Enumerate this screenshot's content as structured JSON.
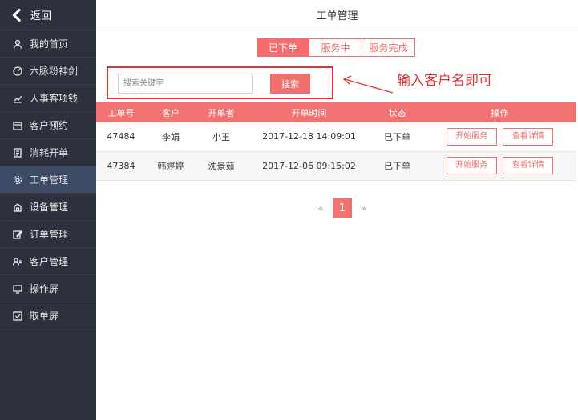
{
  "sidebar": {
    "back_label": "返回",
    "items": [
      {
        "label": "我的首页",
        "icon": "user-icon"
      },
      {
        "label": "六脉粉神剑",
        "icon": "dashboard-icon"
      },
      {
        "label": "人事客项钱",
        "icon": "chart-icon"
      },
      {
        "label": "客户预约",
        "icon": "calendar-icon"
      },
      {
        "label": "消耗开单",
        "icon": "document-icon"
      },
      {
        "label": "工单管理",
        "icon": "gear-icon",
        "active": true
      },
      {
        "label": "设备管理",
        "icon": "building-icon"
      },
      {
        "label": "订单管理",
        "icon": "edit-icon"
      },
      {
        "label": "客户管理",
        "icon": "users-icon"
      },
      {
        "label": "操作屏",
        "icon": "monitor-icon"
      },
      {
        "label": "取单屏",
        "icon": "checkbox-icon"
      }
    ]
  },
  "header": {
    "title": "工单管理"
  },
  "tabs": [
    {
      "label": "已下单",
      "active": true
    },
    {
      "label": "服务中",
      "active": false
    },
    {
      "label": "服务完成",
      "active": false
    }
  ],
  "search": {
    "placeholder": "搜索关键字",
    "button_label": "搜索"
  },
  "annotation": {
    "text": "输入客户名即可"
  },
  "table": {
    "headers": [
      "工单号",
      "客户",
      "开单者",
      "开单时间",
      "状态",
      "操作"
    ],
    "rows": [
      {
        "id": "47484",
        "customer": "李娟",
        "creator": "小王",
        "time": "2017-12-18 14:09:01",
        "status": "已下单"
      },
      {
        "id": "47384",
        "customer": "韩婷婷",
        "creator": "沈景茹",
        "time": "2017-12-06 09:15:02",
        "status": "已下单"
      }
    ],
    "actions": {
      "start": "开始服务",
      "detail": "查看详情"
    }
  },
  "pager": {
    "prev": "«",
    "current": "1",
    "next": "»"
  },
  "colors": {
    "accent": "#f26d6d",
    "sidebar_bg": "#2c313d",
    "sidebar_active": "#3c4a65",
    "annotation_red": "#e03434"
  }
}
